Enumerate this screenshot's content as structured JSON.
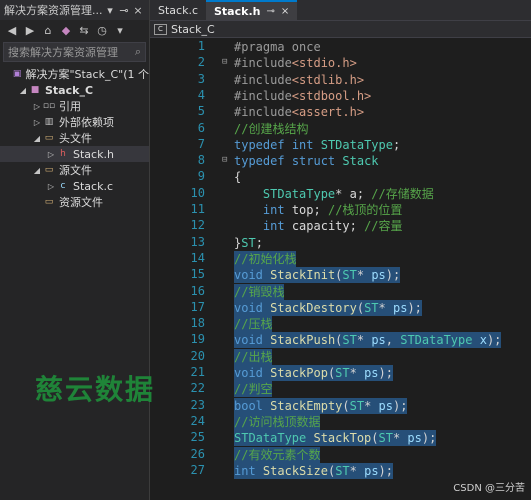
{
  "solution_explorer": {
    "title": "解决方案资源管理...",
    "search_placeholder": "搜索解决方案资源管理",
    "tree": [
      {
        "label": "解决方案\"Stack_C\"(1 个",
        "indent": 0,
        "icon": "solution-icon",
        "bold": false
      },
      {
        "label": "Stack_C",
        "indent": 1,
        "icon": "project-icon",
        "bold": true
      },
      {
        "label": "引用",
        "indent": 2,
        "icon": "references-icon",
        "bold": false
      },
      {
        "label": "外部依赖项",
        "indent": 2,
        "icon": "external-deps-icon",
        "bold": false
      },
      {
        "label": "头文件",
        "indent": 2,
        "icon": "folder-open-icon",
        "bold": false
      },
      {
        "label": "Stack.h",
        "indent": 3,
        "icon": "header-file-icon",
        "bold": false,
        "selected": true
      },
      {
        "label": "源文件",
        "indent": 2,
        "icon": "folder-open-icon",
        "bold": false
      },
      {
        "label": "Stack.c",
        "indent": 3,
        "icon": "c-file-icon",
        "bold": false
      },
      {
        "label": "资源文件",
        "indent": 2,
        "icon": "folder-icon",
        "bold": false
      }
    ]
  },
  "tabs": [
    {
      "label": "Stack.c",
      "active": false
    },
    {
      "label": "Stack.h",
      "active": true,
      "pin": "⊸",
      "close": "×"
    }
  ],
  "navbar": {
    "scope": "Stack_C"
  },
  "code": {
    "line_numbers": [
      "1",
      "2",
      "3",
      "4",
      "5",
      "6",
      "7",
      "8",
      "9",
      "10",
      "11",
      "12",
      "13",
      "14",
      "15",
      "16",
      "17",
      "18",
      "19",
      "20",
      "21",
      "22",
      "23",
      "24",
      "25",
      "26",
      "27"
    ],
    "lines": [
      "#pragma once",
      "#include<stdio.h>",
      "#include<stdlib.h>",
      "#include<stdbool.h>",
      "#include<assert.h>",
      "//创建栈结构",
      "typedef int STDataType;",
      "typedef struct Stack",
      "{",
      "    STDataType* a; //存储数据",
      "    int top; //栈顶的位置",
      "    int capacity; //容量",
      "}ST;",
      "//初始化栈",
      "void StackInit(ST* ps);",
      "//销毁栈",
      "void StackDestory(ST* ps);",
      "//压栈",
      "void StackPush(ST* ps, STDataType x);",
      "//出栈",
      "void StackPop(ST* ps);",
      "//判空",
      "bool StackEmpty(ST* ps);",
      "//访问栈顶数据",
      "STDataType StackTop(ST* ps);",
      "//有效元素个数",
      "int StackSize(ST* ps);"
    ]
  },
  "watermark": "慈云数据",
  "credit": "CSDN @三分苦"
}
